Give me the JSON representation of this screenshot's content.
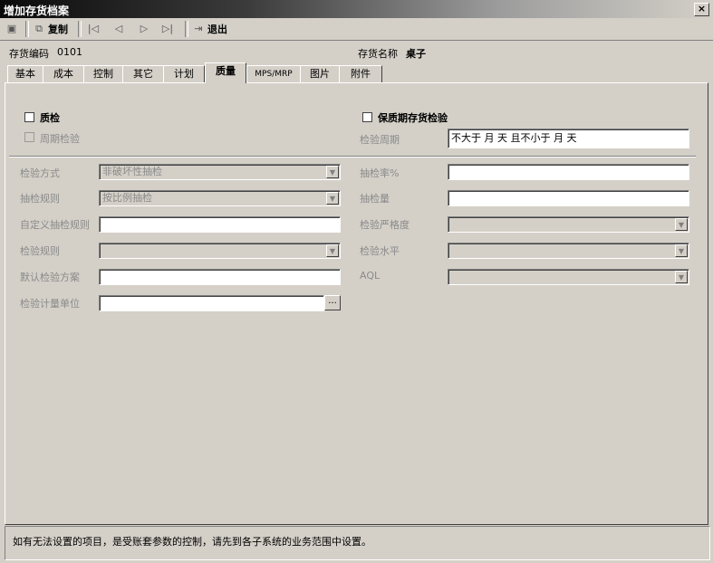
{
  "window": {
    "title": "增加存货档案",
    "close": "×"
  },
  "toolbar": {
    "save_icon": "save-icon",
    "copy_label": "复制",
    "first_icon": "first-record-icon",
    "prev_icon": "prev-record-icon",
    "next_icon": "next-record-icon",
    "last_icon": "last-record-icon",
    "exit_label": "退出"
  },
  "header": {
    "code_label": "存货编码",
    "code_value": "0101",
    "name_label": "存货名称",
    "name_value": "桌子"
  },
  "tabs": [
    "基本",
    "成本",
    "控制",
    "其它",
    "计划",
    "质量",
    "MPS/MRP",
    "图片",
    "附件"
  ],
  "active_tab": "质量",
  "form": {
    "quality_check": "质检",
    "periodic_check": "周期检验",
    "shelf_life_check": "保质期存货检验",
    "check_period_label": "检验周期",
    "check_period_value": "不大于    月    天  且不小于    月    天",
    "check_method_label": "检验方式",
    "check_method_value": "非破坏性抽检",
    "sampling_rule_label": "抽检规则",
    "sampling_rule_value": "按比例抽检",
    "custom_rule_label": "自定义抽检规则",
    "check_rule_label": "检验规则",
    "default_scheme_label": "默认检验方案",
    "unit_label": "检验计量单位",
    "sample_rate_label": "抽检率%",
    "sample_qty_label": "抽检量",
    "strictness_label": "检验严格度",
    "level_label": "检验水平",
    "aql_label": "AQL",
    "ellipsis": "..."
  },
  "status": {
    "message": "如有无法设置的项目，是受账套参数的控制，请先到各子系统的业务范围中设置。"
  }
}
